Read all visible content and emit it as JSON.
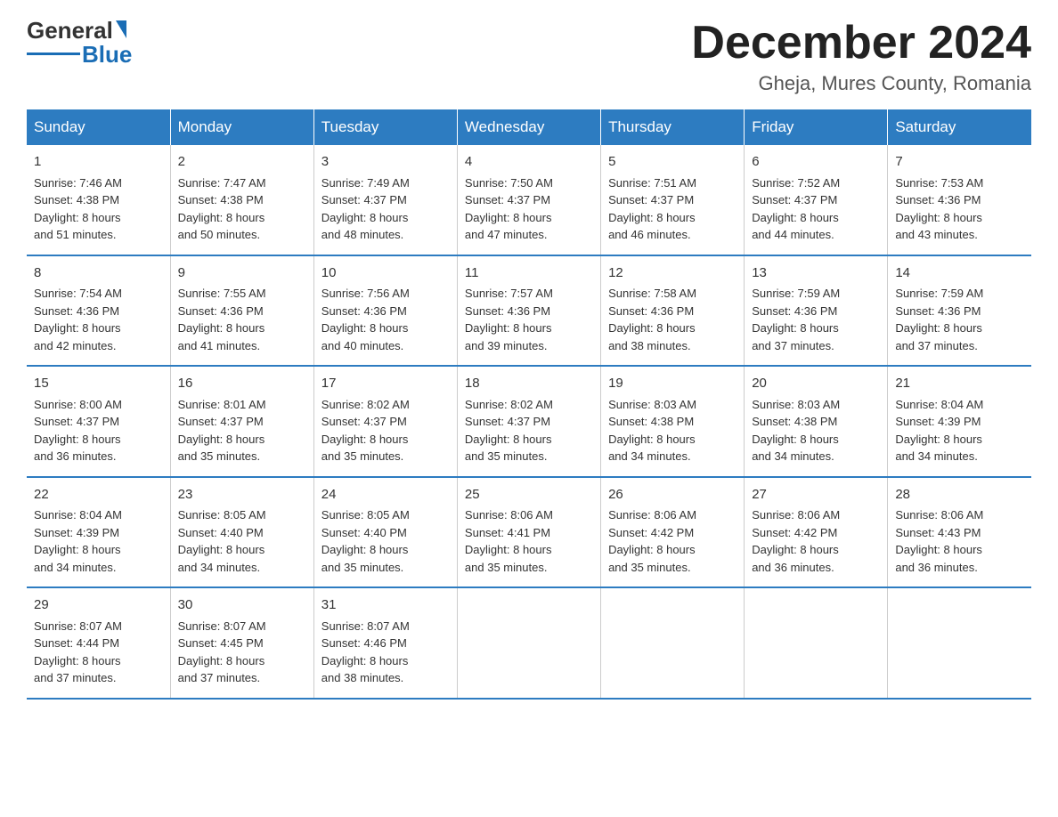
{
  "logo": {
    "text_general": "General",
    "text_blue": "Blue"
  },
  "header": {
    "month_year": "December 2024",
    "location": "Gheja, Mures County, Romania"
  },
  "days_of_week": [
    "Sunday",
    "Monday",
    "Tuesday",
    "Wednesday",
    "Thursday",
    "Friday",
    "Saturday"
  ],
  "weeks": [
    [
      {
        "day": "1",
        "sunrise": "7:46 AM",
        "sunset": "4:38 PM",
        "daylight": "8 hours and 51 minutes."
      },
      {
        "day": "2",
        "sunrise": "7:47 AM",
        "sunset": "4:38 PM",
        "daylight": "8 hours and 50 minutes."
      },
      {
        "day": "3",
        "sunrise": "7:49 AM",
        "sunset": "4:37 PM",
        "daylight": "8 hours and 48 minutes."
      },
      {
        "day": "4",
        "sunrise": "7:50 AM",
        "sunset": "4:37 PM",
        "daylight": "8 hours and 47 minutes."
      },
      {
        "day": "5",
        "sunrise": "7:51 AM",
        "sunset": "4:37 PM",
        "daylight": "8 hours and 46 minutes."
      },
      {
        "day": "6",
        "sunrise": "7:52 AM",
        "sunset": "4:37 PM",
        "daylight": "8 hours and 44 minutes."
      },
      {
        "day": "7",
        "sunrise": "7:53 AM",
        "sunset": "4:36 PM",
        "daylight": "8 hours and 43 minutes."
      }
    ],
    [
      {
        "day": "8",
        "sunrise": "7:54 AM",
        "sunset": "4:36 PM",
        "daylight": "8 hours and 42 minutes."
      },
      {
        "day": "9",
        "sunrise": "7:55 AM",
        "sunset": "4:36 PM",
        "daylight": "8 hours and 41 minutes."
      },
      {
        "day": "10",
        "sunrise": "7:56 AM",
        "sunset": "4:36 PM",
        "daylight": "8 hours and 40 minutes."
      },
      {
        "day": "11",
        "sunrise": "7:57 AM",
        "sunset": "4:36 PM",
        "daylight": "8 hours and 39 minutes."
      },
      {
        "day": "12",
        "sunrise": "7:58 AM",
        "sunset": "4:36 PM",
        "daylight": "8 hours and 38 minutes."
      },
      {
        "day": "13",
        "sunrise": "7:59 AM",
        "sunset": "4:36 PM",
        "daylight": "8 hours and 37 minutes."
      },
      {
        "day": "14",
        "sunrise": "7:59 AM",
        "sunset": "4:36 PM",
        "daylight": "8 hours and 37 minutes."
      }
    ],
    [
      {
        "day": "15",
        "sunrise": "8:00 AM",
        "sunset": "4:37 PM",
        "daylight": "8 hours and 36 minutes."
      },
      {
        "day": "16",
        "sunrise": "8:01 AM",
        "sunset": "4:37 PM",
        "daylight": "8 hours and 35 minutes."
      },
      {
        "day": "17",
        "sunrise": "8:02 AM",
        "sunset": "4:37 PM",
        "daylight": "8 hours and 35 minutes."
      },
      {
        "day": "18",
        "sunrise": "8:02 AM",
        "sunset": "4:37 PM",
        "daylight": "8 hours and 35 minutes."
      },
      {
        "day": "19",
        "sunrise": "8:03 AM",
        "sunset": "4:38 PM",
        "daylight": "8 hours and 34 minutes."
      },
      {
        "day": "20",
        "sunrise": "8:03 AM",
        "sunset": "4:38 PM",
        "daylight": "8 hours and 34 minutes."
      },
      {
        "day": "21",
        "sunrise": "8:04 AM",
        "sunset": "4:39 PM",
        "daylight": "8 hours and 34 minutes."
      }
    ],
    [
      {
        "day": "22",
        "sunrise": "8:04 AM",
        "sunset": "4:39 PM",
        "daylight": "8 hours and 34 minutes."
      },
      {
        "day": "23",
        "sunrise": "8:05 AM",
        "sunset": "4:40 PM",
        "daylight": "8 hours and 34 minutes."
      },
      {
        "day": "24",
        "sunrise": "8:05 AM",
        "sunset": "4:40 PM",
        "daylight": "8 hours and 35 minutes."
      },
      {
        "day": "25",
        "sunrise": "8:06 AM",
        "sunset": "4:41 PM",
        "daylight": "8 hours and 35 minutes."
      },
      {
        "day": "26",
        "sunrise": "8:06 AM",
        "sunset": "4:42 PM",
        "daylight": "8 hours and 35 minutes."
      },
      {
        "day": "27",
        "sunrise": "8:06 AM",
        "sunset": "4:42 PM",
        "daylight": "8 hours and 36 minutes."
      },
      {
        "day": "28",
        "sunrise": "8:06 AM",
        "sunset": "4:43 PM",
        "daylight": "8 hours and 36 minutes."
      }
    ],
    [
      {
        "day": "29",
        "sunrise": "8:07 AM",
        "sunset": "4:44 PM",
        "daylight": "8 hours and 37 minutes."
      },
      {
        "day": "30",
        "sunrise": "8:07 AM",
        "sunset": "4:45 PM",
        "daylight": "8 hours and 37 minutes."
      },
      {
        "day": "31",
        "sunrise": "8:07 AM",
        "sunset": "4:46 PM",
        "daylight": "8 hours and 38 minutes."
      },
      null,
      null,
      null,
      null
    ]
  ],
  "labels": {
    "sunrise": "Sunrise:",
    "sunset": "Sunset:",
    "daylight": "Daylight:"
  }
}
